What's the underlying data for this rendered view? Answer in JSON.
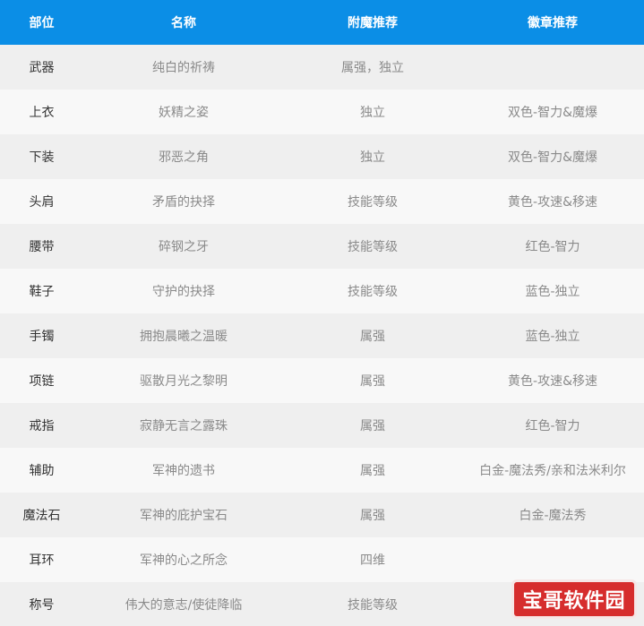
{
  "headers": [
    "部位",
    "名称",
    "附魔推荐",
    "徽章推荐"
  ],
  "rows": [
    [
      "武器",
      "纯白的祈祷",
      "属强，独立",
      ""
    ],
    [
      "上衣",
      "妖精之姿",
      "独立",
      "双色-智力&魔爆"
    ],
    [
      "下装",
      "邪恶之角",
      "独立",
      "双色-智力&魔爆"
    ],
    [
      "头肩",
      "矛盾的抉择",
      "技能等级",
      "黄色-攻速&移速"
    ],
    [
      "腰带",
      "碎钢之牙",
      "技能等级",
      "红色-智力"
    ],
    [
      "鞋子",
      "守护的抉择",
      "技能等级",
      "蓝色-独立"
    ],
    [
      "手镯",
      "拥抱晨曦之温暖",
      "属强",
      "蓝色-独立"
    ],
    [
      "项链",
      "驱散月光之黎明",
      "属强",
      "黄色-攻速&移速"
    ],
    [
      "戒指",
      "寂静无言之露珠",
      "属强",
      "红色-智力"
    ],
    [
      "辅助",
      "军神的遗书",
      "属强",
      "白金-魔法秀/亲和法米利尔"
    ],
    [
      "魔法石",
      "军神的庇护宝石",
      "属强",
      "白金-魔法秀"
    ],
    [
      "耳环",
      "军神的心之所念",
      "四维",
      ""
    ],
    [
      "称号",
      "伟大的意志/使徒降临",
      "技能等级",
      ""
    ]
  ],
  "watermark": "宝哥软件园",
  "colors": {
    "header_bg": "#0b8ee6",
    "row_odd": "#efefef",
    "row_even": "#f8f8f8",
    "watermark_bg": "#d62d2d"
  }
}
